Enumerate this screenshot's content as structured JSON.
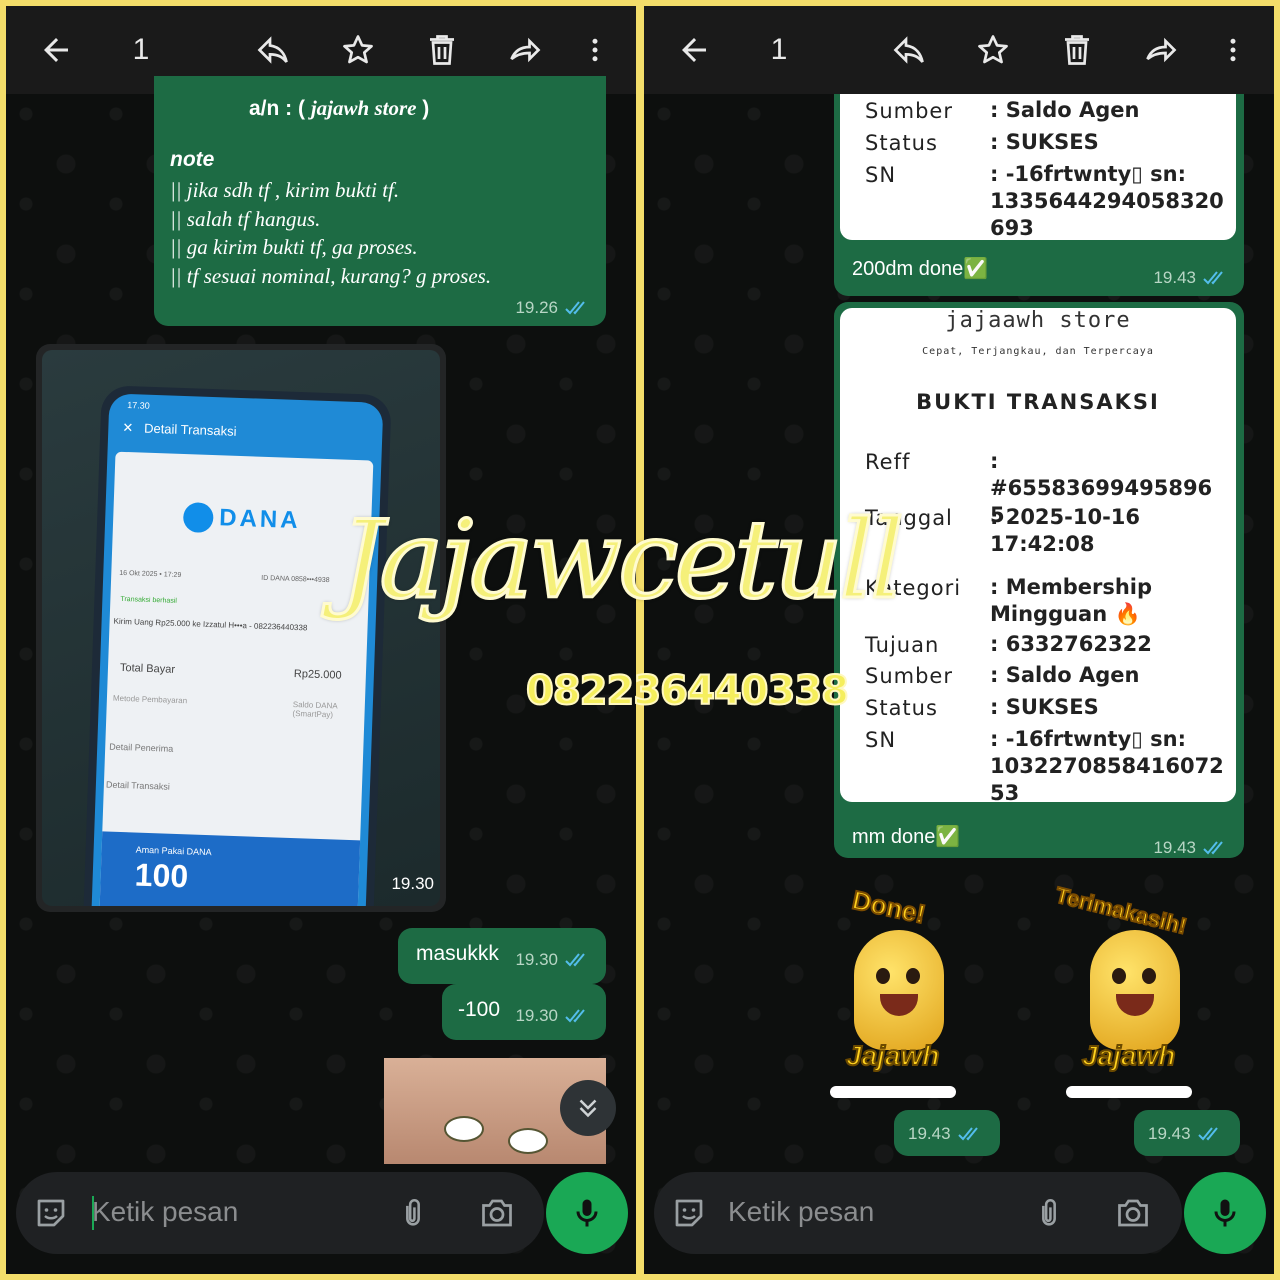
{
  "left": {
    "header": {
      "count": "1"
    },
    "note_message": {
      "account_line_prefix": "a/n : (",
      "account_name": "jajawh store",
      "account_line_suffix": ")",
      "note_title": "note",
      "lines": [
        "|| jika sdh tf , kirim bukti tf.",
        "|| salah tf hangus.",
        "|| ga kirim bukti tf, ga proses.",
        "|| tf sesuai nominal, kurang? g proses."
      ],
      "time": "19.26"
    },
    "photo_message": {
      "time": "19.30",
      "phone": {
        "status_time": "17.30",
        "title": "Detail Transaksi",
        "brand": "DANA",
        "date": "16 Okt 2025 • 17:29",
        "id": "ID DANA 0858•••4938",
        "status": "Transaksi berhasil",
        "desc": "Kirim Uang Rp25.000 ke Izzatul H•••a - 082236440338",
        "total_label": "Total Bayar",
        "total_value": "Rp25.000",
        "method_label": "Metode Pembayaran",
        "method_value": "Saldo DANA (SmartPay)",
        "recipient": "Detail Penerima",
        "detail": "Detail Transaksi",
        "promo": "Aman Pakai DANA",
        "promo_big": "100"
      }
    },
    "msg_masuk": {
      "text": "masukkk",
      "time": "19.30"
    },
    "msg_minus": {
      "text": "-100",
      "time": "19.30"
    },
    "input": {
      "placeholder": "Ketik pesan"
    }
  },
  "right": {
    "header": {
      "count": "1"
    },
    "receipt1": {
      "rows": [
        {
          "label": "Sumber",
          "value": ": Saldo Agen"
        },
        {
          "label": "Status",
          "value": ": SUKSES"
        },
        {
          "label": "SN",
          "value": ": -16frtwnty▯ sn: 1335644294058320 693"
        }
      ],
      "caption": "200dm done✅",
      "time": "19.43"
    },
    "receipt2": {
      "store": "jajaawh store",
      "tagline": "Cepat, Terjangkau, dan Terpercaya",
      "heading": "BUKTI TRANSAKSI",
      "rows": [
        {
          "label": "Reff",
          "value": ": #65583699495896 5"
        },
        {
          "label": "Tanggal",
          "value": ": 2025-10-16 17:42:08"
        },
        {
          "label": "Kategori",
          "value": ": Membership Mingguan 🔥"
        },
        {
          "label": "Tujuan",
          "value": ": 6332762322"
        },
        {
          "label": "Sumber",
          "value": ": Saldo Agen"
        },
        {
          "label": "Status",
          "value": ": SUKSES"
        },
        {
          "label": "SN",
          "value": ": -16frtwnty▯ sn: 1032270858416072 53"
        }
      ],
      "caption": "mm done✅",
      "time": "19.43"
    },
    "sticker1": {
      "text": "Done!",
      "brand": "Jajawh",
      "time": "19.43"
    },
    "sticker2": {
      "text": "Terimakasih!",
      "brand": "Jajawh",
      "time": "19.43"
    },
    "input": {
      "placeholder": "Ketik pesan"
    }
  },
  "watermark": {
    "name": "Jajawcetull",
    "number": "082236440338"
  },
  "colors": {
    "outgoing": "#1d6b44",
    "accent": "#1aa855",
    "frame": "#f3dd6a",
    "tick": "#53bdeb"
  }
}
